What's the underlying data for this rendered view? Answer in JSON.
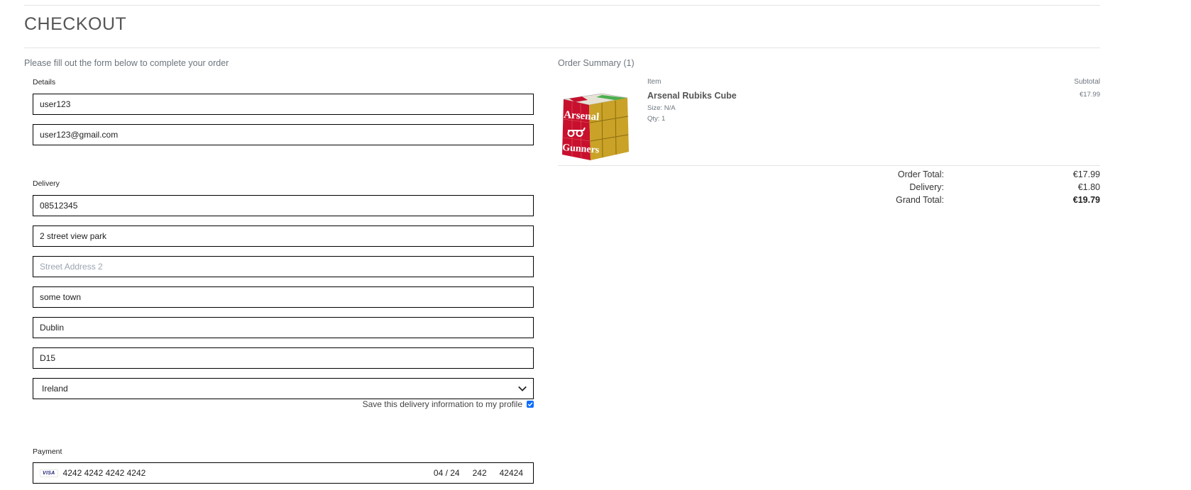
{
  "page": {
    "title": "CHECKOUT"
  },
  "form": {
    "intro": "Please fill out the form below to complete your order",
    "details": {
      "legend": "Details",
      "full_name": "user123",
      "email": "user123@gmail.com"
    },
    "delivery": {
      "legend": "Delivery",
      "phone": "08512345",
      "street_address_1": "2 street view park",
      "street_address_2_placeholder": "Street Address 2",
      "town": "some town",
      "county": "Dublin",
      "postcode": "D15",
      "country_selected": "Ireland",
      "save_info_label": "Save this delivery information to my profile",
      "save_info_checked": true
    },
    "payment": {
      "legend": "Payment",
      "card_brand": "VISA",
      "card_number": "4242 4242 4242 4242",
      "expiry": "04 / 24",
      "cvc": "242",
      "zip": "42424"
    }
  },
  "summary": {
    "title": "Order Summary (1)",
    "col_item": "Item",
    "col_subtotal": "Subtotal",
    "items": [
      {
        "name": "Arsenal Rubiks Cube",
        "size": "Size: N/A",
        "qty": "Qty: 1",
        "subtotal": "€17.99",
        "image_text_top": "Arsenal",
        "image_text_bottom": "Gunners"
      }
    ],
    "order_total_label": "Order Total:",
    "order_total": "€17.99",
    "delivery_label": "Delivery:",
    "delivery": "€1.80",
    "grand_total_label": "Grand Total:",
    "grand_total": "€19.79"
  },
  "colors": {
    "checkbox": "#0d6efd",
    "cube_red": "#c8102e",
    "cube_gold": "#c9a227"
  }
}
